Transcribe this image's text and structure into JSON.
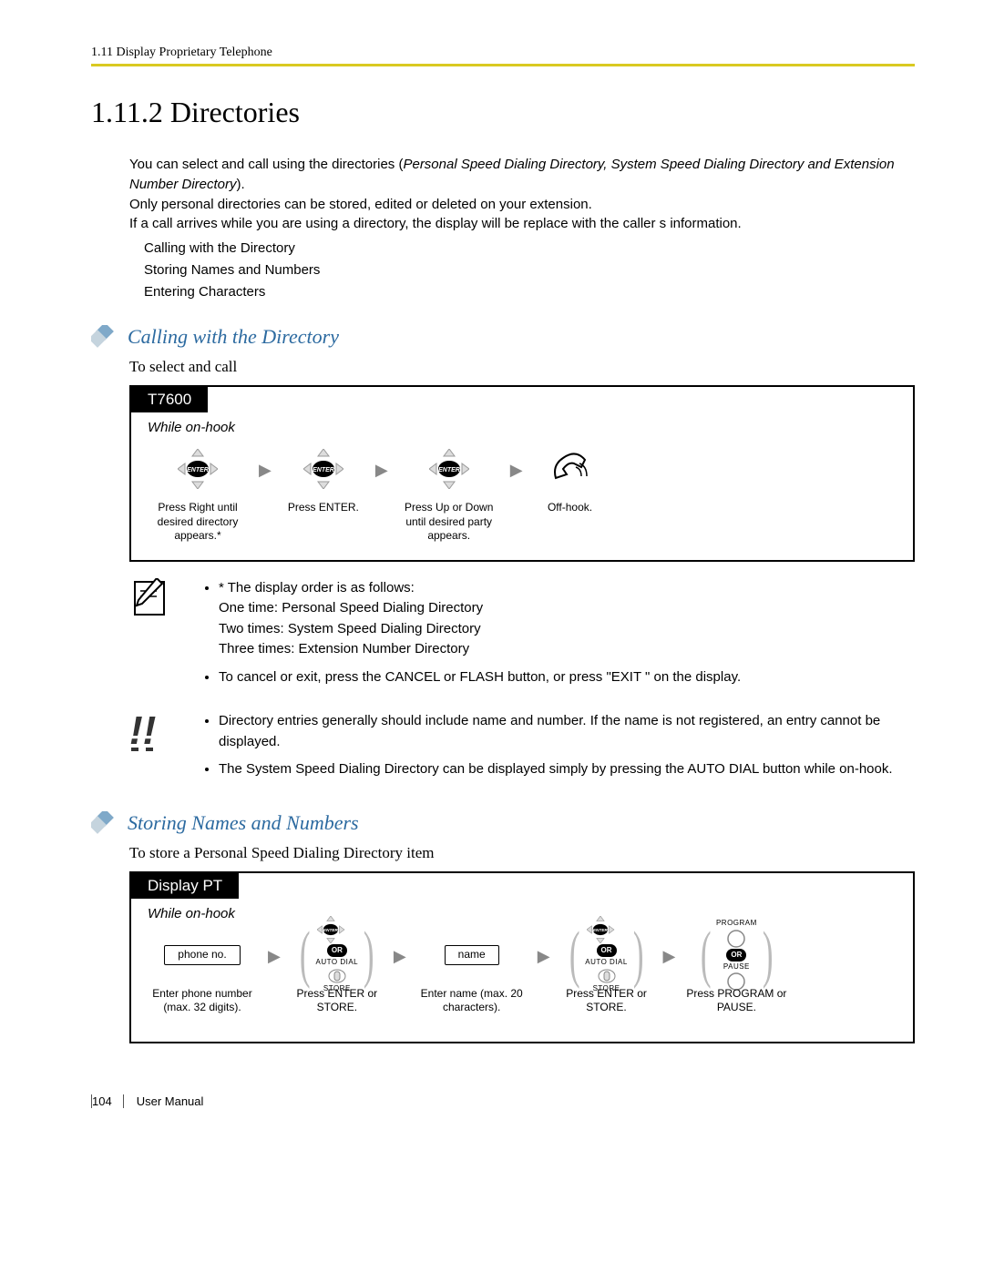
{
  "header": {
    "text": "1.11 Display Proprietary Telephone"
  },
  "section": {
    "number_title": "1.11.2  Directories",
    "intro1a": "You can select and call using the directories (",
    "intro1b": "Personal Speed Dialing Directory, System Speed Dialing Directory and Extension Number Directory",
    "intro1c": ").",
    "intro2": "Only personal directories can be stored, edited or deleted on your extension.",
    "intro3": "If a call arrives while you are using a directory, the display will be replace with the caller s information.",
    "bullets": [
      "Calling with the Directory",
      "Storing Names and Numbers",
      "Entering Characters"
    ]
  },
  "calling": {
    "heading": "Calling with the Directory",
    "sub": "To select and call",
    "tab": "T7600",
    "hook": "While on-hook",
    "steps": {
      "s1": "Press Right  until desired directory appears.*",
      "s2": "Press ENTER.",
      "s3": "Press Up or Down until desired party  appears.",
      "s4": "Off-hook."
    },
    "note1": {
      "l0": "* The display order is as follows:",
      "l1": "One time: Personal Speed Dialing Directory",
      "l2": "Two times: System Speed Dialing Directory",
      "l3": "Three times: Extension Number Directory",
      "l4": "To cancel or exit, press the CANCEL or FLASH button, or press \"EXIT \" on the display."
    },
    "note2": {
      "l0": "Directory entries generally should include name and number. If the name is not registered, an entry cannot be displayed.",
      "l1": "The System Speed Dialing Directory can be displayed simply by pressing the AUTO DIAL button while on-hook."
    }
  },
  "storing": {
    "heading": "Storing Names and Numbers",
    "sub": "To store a Personal Speed Dialing Directory item",
    "tab": "Display PT",
    "hook": "While on-hook",
    "steps": {
      "phone_box": "phone no.",
      "s1": "Enter phone number (max. 32 digits).",
      "s2": "Press ENTER or STORE.",
      "name_box": "name",
      "s3": "Enter name (max. 20 characters).",
      "s4": "Press ENTER or STORE.",
      "s5": "Press PROGRAM or PAUSE.",
      "or": "OR",
      "autodial": "AUTO DIAL",
      "store": "STORE",
      "program": "PROGRAM",
      "pause": "PAUSE"
    }
  },
  "footer": {
    "page": "104",
    "manual": "User Manual"
  }
}
